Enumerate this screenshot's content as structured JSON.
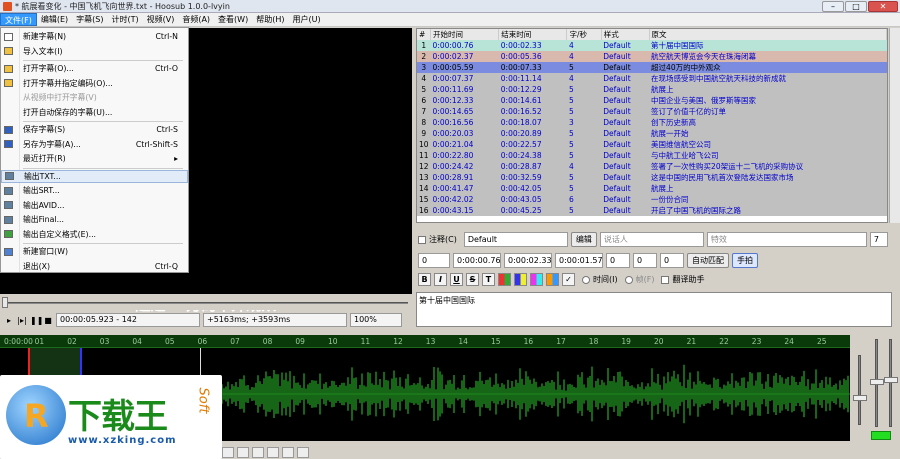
{
  "window": {
    "title": "* 航展看变化 - 中国飞机飞向世界.txt - Hoosub 1.0.0-lvyin"
  },
  "menubar": [
    "文件(F)",
    "编辑(E)",
    "字幕(S)",
    "计时(T)",
    "视频(V)",
    "音频(A)",
    "查看(W)",
    "帮助(H)",
    "用户(U)"
  ],
  "file_menu": [
    {
      "label": "新建字幕(N)",
      "shortcut": "Ctrl-N",
      "disabled": false,
      "icon": "new-file-icon"
    },
    {
      "label": "导入文本(I)",
      "shortcut": "",
      "disabled": false,
      "icon": "import-icon"
    },
    {
      "label": "打开字幕(O)...",
      "shortcut": "Ctrl-O",
      "disabled": false,
      "icon": "open-folder-icon"
    },
    {
      "label": "打开字幕并指定编码(O)...",
      "shortcut": "",
      "disabled": false,
      "icon": "open-folder-icon"
    },
    {
      "label": "从视频中打开字幕(V)",
      "shortcut": "",
      "disabled": true,
      "icon": ""
    },
    {
      "label": "打开自动保存的字幕(U)...",
      "shortcut": "",
      "disabled": false,
      "icon": ""
    },
    {
      "label": "保存字幕(S)",
      "shortcut": "Ctrl-S",
      "disabled": false,
      "icon": "save-icon"
    },
    {
      "label": "另存为字幕(A)...",
      "shortcut": "Ctrl-Shift-S",
      "disabled": false,
      "icon": "save-as-icon"
    },
    {
      "label": "最近打开(R)",
      "shortcut": "▸",
      "disabled": false,
      "icon": ""
    },
    {
      "label": "输出TXT...",
      "shortcut": "",
      "disabled": false,
      "icon": "export-icon"
    },
    {
      "label": "输出SRT...",
      "shortcut": "",
      "disabled": false,
      "icon": "export-icon"
    },
    {
      "label": "输出AVID...",
      "shortcut": "",
      "disabled": false,
      "icon": "export-icon"
    },
    {
      "label": "输出Final...",
      "shortcut": "",
      "disabled": false,
      "icon": "export-icon"
    },
    {
      "label": "输出自定义格式(E)...",
      "shortcut": "",
      "disabled": false,
      "icon": "custom-export-icon"
    },
    {
      "label": "新建窗口(W)",
      "shortcut": "",
      "disabled": false,
      "icon": "new-window-icon"
    },
    {
      "label": "退出(X)",
      "shortcut": "Ctrl-Q",
      "disabled": false,
      "icon": ""
    }
  ],
  "video": {
    "subtitle": "超过40万的中外观众",
    "time": "00:00:05.923 - 142",
    "offset": "+5163ms; +3593ms",
    "zoom": "100%"
  },
  "grid": {
    "headers": [
      "#",
      "开始时间",
      "结束时间",
      "字/秒",
      "样式",
      "原文"
    ],
    "rows": [
      [
        "1",
        "0:00:00.76",
        "0:00:02.33",
        "4",
        "Default",
        "第十届中国国际"
      ],
      [
        "2",
        "0:00:02.37",
        "0:00:05.36",
        "4",
        "Default",
        "航空航天博览会今天在珠海闭幕"
      ],
      [
        "3",
        "0:00:05.59",
        "0:00:07.33",
        "5",
        "Default",
        "超过40万的中外观众"
      ],
      [
        "4",
        "0:00:07.37",
        "0:00:11.14",
        "4",
        "Default",
        "在现场感受到中国航空航天科技的新成就"
      ],
      [
        "5",
        "0:00:11.69",
        "0:00:12.29",
        "5",
        "Default",
        "航展上"
      ],
      [
        "6",
        "0:00:12.33",
        "0:00:14.61",
        "5",
        "Default",
        "中国企业与美国、俄罗斯等国家"
      ],
      [
        "7",
        "0:00:14.65",
        "0:00:16.52",
        "5",
        "Default",
        "签订了价值千亿的订单"
      ],
      [
        "8",
        "0:00:16.56",
        "0:00:18.07",
        "3",
        "Default",
        "创下历史新高"
      ],
      [
        "9",
        "0:00:20.03",
        "0:00:20.89",
        "5",
        "Default",
        "航展一开始"
      ],
      [
        "10",
        "0:00:21.04",
        "0:00:22.57",
        "5",
        "Default",
        "美国维信航空公司"
      ],
      [
        "11",
        "0:00:22.80",
        "0:00:24.38",
        "5",
        "Default",
        "与中航工业哈飞公司"
      ],
      [
        "12",
        "0:00:24.42",
        "0:00:28.87",
        "4",
        "Default",
        "签署了一次性购买20架运十二飞机的采购协议"
      ],
      [
        "13",
        "0:00:28.91",
        "0:00:32.59",
        "5",
        "Default",
        "这是中国的民用飞机首次登陆发达国家市场"
      ],
      [
        "14",
        "0:00:41.47",
        "0:00:42.05",
        "5",
        "Default",
        "航展上"
      ],
      [
        "15",
        "0:00:42.02",
        "0:00:43.05",
        "6",
        "Default",
        "一份份合同"
      ],
      [
        "16",
        "0:00:43.15",
        "0:00:45.25",
        "5",
        "Default",
        "开启了中国飞机的国际之路"
      ]
    ]
  },
  "editor": {
    "comment_label": "注释(C)",
    "style": "Default",
    "edit_button": "编辑",
    "actor_placeholder": "说话人",
    "effect_placeholder": "特效",
    "layer_right": "7",
    "layer": "0",
    "start": "0:00:00.76",
    "end": "0:00:02.33",
    "duration": "0:00:01.57",
    "margin_l": "0",
    "margin_r": "0",
    "margin_v": "0",
    "auto_match": "自动匹配",
    "manual": "手拍",
    "fmt_buttons": [
      "B",
      "I",
      "U",
      "S",
      "T"
    ],
    "radio_time": "时间(I)",
    "radio_frame": "帧(F)",
    "translate_helper": "翻译助手",
    "text": "第十届中国国际"
  },
  "waveform": {
    "ticks": [
      "0:00:00",
      "01",
      "02",
      "03",
      "04",
      "05",
      "06",
      "07",
      "08",
      "09",
      "10",
      "11",
      "12",
      "13",
      "14",
      "15",
      "16",
      "17",
      "18",
      "19",
      "20",
      "21",
      "22",
      "23",
      "24",
      "25"
    ]
  },
  "logo": {
    "mark": "R",
    "name": "下载王",
    "soft": "Soft",
    "url": "www.xzking.com"
  }
}
